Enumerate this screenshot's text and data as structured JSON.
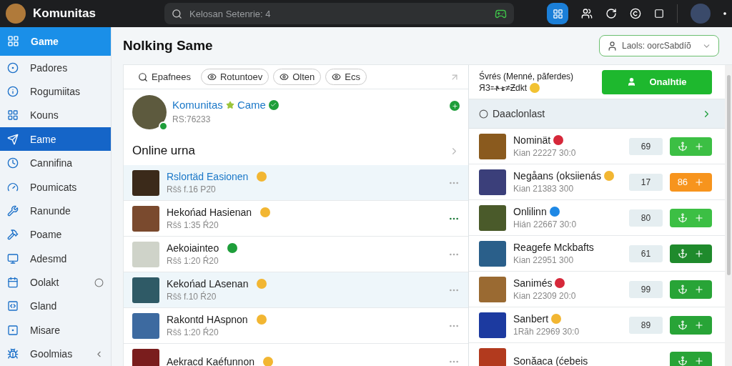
{
  "topbar": {
    "app_name": "Komunitas",
    "search": {
      "placeholder": "Kelosan Setenrie: 4"
    }
  },
  "sidebar": {
    "header": {
      "label": "Game",
      "selected": true
    },
    "items": [
      {
        "label": "Padores",
        "selected": false
      },
      {
        "label": "Rogumiitas",
        "selected": false
      },
      {
        "label": "Kouns",
        "selected": false
      },
      {
        "label": "Eame",
        "selected": true
      },
      {
        "label": "Cannifina",
        "selected": false
      },
      {
        "label": "Poumicats",
        "selected": false
      },
      {
        "label": "Ranunde",
        "selected": false
      },
      {
        "label": "Poame",
        "selected": false
      },
      {
        "label": "Adesmd",
        "selected": false
      },
      {
        "label": "Oolakt",
        "selected": false,
        "kind": "circle"
      },
      {
        "label": "Gland",
        "selected": false
      },
      {
        "label": "Misare",
        "selected": false
      },
      {
        "label": "Goolmias",
        "selected": false,
        "kind": "chevron"
      }
    ]
  },
  "page": {
    "title": "Nolking Same",
    "account": {
      "label": "Laols: oorcSabdíõ"
    }
  },
  "filters": [
    {
      "label": "Epafnees",
      "kind": "search"
    },
    {
      "label": "Rotuntoev",
      "kind": "chip"
    },
    {
      "label": "Olten",
      "kind": "chip"
    },
    {
      "label": "Ecs",
      "kind": "chip"
    }
  ],
  "profile": {
    "name": "Komunitas",
    "game": "Came",
    "id": "RS:76233"
  },
  "online": {
    "title": "Online urna",
    "rows": [
      {
        "name": "Rslortäd Easionen",
        "sub": "Rŝŝ f.16 P2̈0",
        "color": "#f2b632",
        "selected": true
      },
      {
        "name": "Hekońad Hasienan",
        "sub": "Rŝŝ 1:35 Ŕ20",
        "color": "#f2b632",
        "selected": false
      },
      {
        "name": "Aekoiainteo",
        "sub": "Rŝŝ 1:20 Ŕ20",
        "color": "#1e9e3a",
        "selected": false
      },
      {
        "name": "Kekońad LAsenan",
        "sub": "Rŝŝ f.10 Ŕ20",
        "color": "#f2b632",
        "selected": true
      },
      {
        "name": "Rakontd HAspnon",
        "sub": "Rŝŝ 1:20 Ŕ20",
        "color": "#f2b632",
        "selected": false
      },
      {
        "name": "Aekracd Kaéfunnon",
        "color": "#f2b632",
        "selected": false
      }
    ]
  },
  "right": {
    "heading_1": "Śvrés (Menné, păferdes)",
    "heading_2": "ЯЗ꞊ቶቴ≠Ƶdkt",
    "button": "Onalhtie",
    "section": "Daaclonlast",
    "rows": [
      {
        "name": "Nominät",
        "sub": "Kian 22227 30:0",
        "count": "69",
        "color": "#d6283a",
        "action": {
          "kind": "icon",
          "color": "#3cbf44"
        }
      },
      {
        "name": "Negåans (oksiienás",
        "sub": "Kian 21383 300",
        "count": "17",
        "color": "#f2b632",
        "action": {
          "kind": "count",
          "label": "86",
          "color": "#f7941d"
        }
      },
      {
        "name": "Onlilinn",
        "sub": "Hián 22667 30:0",
        "count": "80",
        "color": "#1e88e5",
        "action": {
          "kind": "icon",
          "color": "#3cbf44"
        }
      },
      {
        "name": "Reagefe Mckbafts",
        "sub": "Kian 22951 300",
        "count": "61",
        "action": {
          "kind": "icon",
          "color": "#1f8a2c"
        }
      },
      {
        "name": "Sanimés",
        "sub": "Kian 22309 20:0",
        "count": "99",
        "color": "#d6283a",
        "action": {
          "kind": "icon",
          "color": "#28a437"
        }
      },
      {
        "name": "Sanbert",
        "sub": "1Rãh 22969 30:0",
        "count": "89",
        "color": "#f2b632",
        "action": {
          "kind": "icon",
          "color": "#28a437"
        }
      },
      {
        "name": "Sonăaca (ćebeis",
        "action": {
          "kind": "icon",
          "color": "#28a437"
        }
      }
    ]
  }
}
